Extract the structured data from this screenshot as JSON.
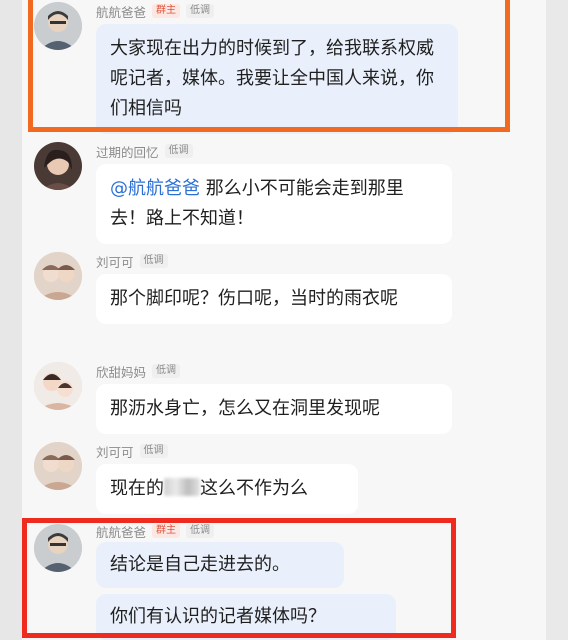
{
  "messages": [
    {
      "sender": "航航爸爸",
      "badges": [
        "群主",
        "低调"
      ],
      "text": "大家现在出力的时候到了，给我联系权威呢记者，媒体。我要让全中国人来说，你们相信吗"
    },
    {
      "sender": "过期的回忆",
      "badges": [
        "低调"
      ],
      "mention": "@航航爸爸",
      "text": " 那么小不可能会走到那里去！路上不知道！"
    },
    {
      "sender": "刘可可",
      "badges": [
        "低调"
      ],
      "text": "那个脚印呢？伤口呢，当时的雨衣呢"
    },
    {
      "sender": "欣甜妈妈",
      "badges": [
        "低调"
      ],
      "text": "那沥水身亡，怎么又在洞里发现呢"
    },
    {
      "sender": "刘可可",
      "badges": [
        "低调"
      ],
      "text_before": "现在的",
      "text_after": "这么不作为么"
    },
    {
      "sender": "航航爸爸",
      "badges": [
        "群主",
        "低调"
      ],
      "texts": [
        "结论是自己走进去的。",
        "你们有认识的记者媒体吗？"
      ]
    }
  ],
  "colors": {
    "highlight_orange": "#f26a22",
    "highlight_red": "#ef2a1e",
    "owner_badge": "#e0533a",
    "mention": "#2b6fd6"
  }
}
